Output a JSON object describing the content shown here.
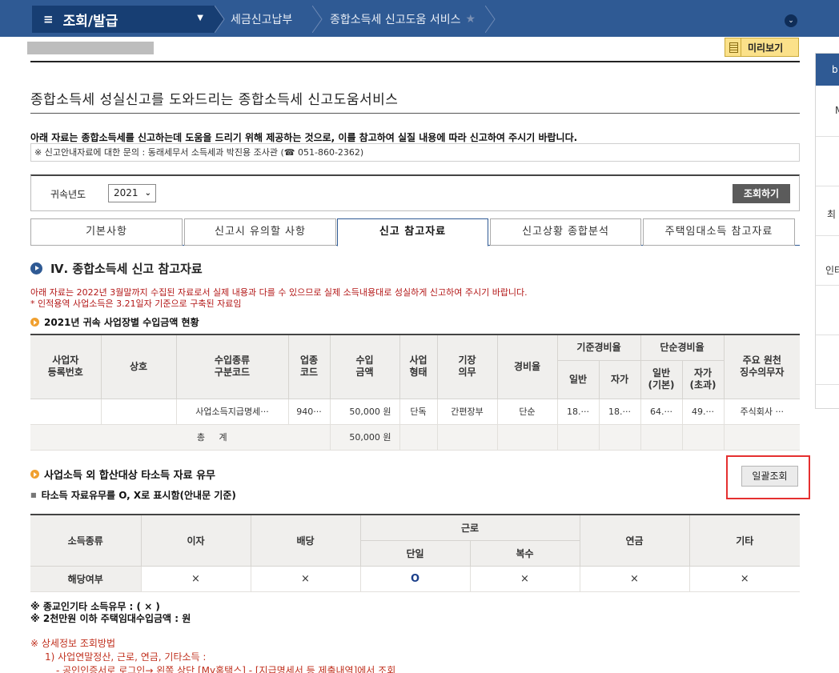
{
  "nav": {
    "menu_label": "조회/발급",
    "breadcrumbs": [
      "세금신고납부",
      "종합소득세 신고도움 서비스"
    ]
  },
  "right_panel": {
    "head": "b",
    "items": [
      "M",
      "",
      "최",
      "인터",
      "",
      "",
      ""
    ]
  },
  "preview_label": "미리보기",
  "page_title": "종합소득세 성실신고를 도와드리는 종합소득세 신고도움서비스",
  "intro": "아래 자료는 종합소득세를 신고하는데 도움을 드리기 위해 제공하는 것으로, 이를 참고하여 실질 내용에 따라 신고하여 주시기 바랍니다.",
  "notice": "※ 신고안내자료에 대한 문의 : 동래세무서 소득세과 박진용 조사관 (☎ 051-860-2362)",
  "filter": {
    "label": "귀속년도",
    "year": "2021",
    "search_label": "조회하기"
  },
  "tabs": [
    "기본사항",
    "신고시 유의할 사항",
    "신고 참고자료",
    "신고상황 종합분석",
    "주택임대소득 참고자료"
  ],
  "section": {
    "title": "Ⅳ. 종합소득세 신고 참고자료",
    "note1": "아래 자료는 2022년 3월말까지 수집된 자료로서 실제 내용과 다를 수 있으므로 실제 소득내용대로 성실하게 신고하여 주시기 바랍니다.",
    "note2": "* 인적용역 사업소득은 3.21일자 기준으로 구축된 자료임",
    "sub1": "2021년 귀속 사업장별 수입금액 현황"
  },
  "income_table": {
    "headers": {
      "reg_no": "사업자\n등록번호",
      "name": "상호",
      "type_code": "수입종류\n구분코드",
      "industry": "업종\n코드",
      "revenue": "수입\n금액",
      "biz_type": "사업\n형태",
      "bookkeeping": "기장\n의무",
      "rate": "경비율",
      "std_rate": "기준경비율",
      "simple_rate": "단순경비율",
      "general": "일반",
      "self": "자가",
      "general_basic": "일반\n(기본)",
      "self_excess": "자가\n(초과)",
      "payer": "주요 원천\n징수의무자"
    },
    "row": {
      "reg_no": "",
      "name": "",
      "type_code": "사업소득지급명세···",
      "industry": "940···",
      "revenue": "50,000 원",
      "biz_type": "단독",
      "bookkeeping": "간편장부",
      "rate": "단순",
      "general": "18.···",
      "self": "18.···",
      "general_basic": "64.···",
      "self_excess": "49.···",
      "payer": "주식회사 ···"
    },
    "total": {
      "label": "총 계",
      "revenue": "50,000 원"
    }
  },
  "other_income": {
    "title": "사업소득 외 합산대상 타소득 자료 유무",
    "subtitle": "타소득 자료유무를 O, X로 표시함(안내문 기준)",
    "bulk_label": "일괄조회",
    "headers": {
      "kind": "소득종류",
      "interest": "이자",
      "dividend": "배당",
      "labor": "근로",
      "single": "단일",
      "multiple": "복수",
      "pension": "연금",
      "other": "기타"
    },
    "row": {
      "label": "해당여부",
      "interest": "×",
      "dividend": "×",
      "single": "O",
      "multiple": "×",
      "pension": "×",
      "other": "×"
    }
  },
  "footnotes": {
    "religious": "※ 종교인기타 소득유무 : ( × )",
    "rental": "※ 2천만원 이하 주택임대수입금액 : 원"
  },
  "detail": {
    "title": "※  상세정보 조회방법",
    "line1": "1) 사업연말정산, 근로, 연금, 기타소득 :",
    "line2": "- 공인인증서로 로그인→ 왼쪽 상단 [My홈택스] - [지급명세서 등 제출내역]에서 조회"
  }
}
